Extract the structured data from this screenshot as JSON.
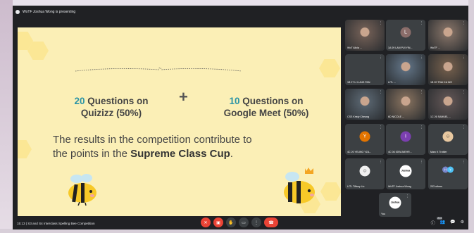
{
  "meeting": {
    "presenting_text": "WoTF Joshua Wong is presenting",
    "time": "15:13",
    "separator": "|",
    "title": "S3 and S4 Interclass Spelling Bee Competition"
  },
  "slide": {
    "quizizz_count": "20",
    "quizizz_rest": "Questions on",
    "quizizz_line2": "Quizizz (50%)",
    "plus": "+",
    "meet_count": "10",
    "meet_rest": "Questions on",
    "meet_line2": "Google Meet (50%)",
    "results_line1": "The results in the competition contribute to",
    "results_line2_pre": "the points in the ",
    "results_line2_bold": "Supreme Class Cup",
    "results_line2_post": "."
  },
  "participants": [
    {
      "name": "WoT Alicia ...",
      "type": "photo"
    },
    {
      "name": "1A 09 LAM PUI YIN...",
      "type": "avatar",
      "initial": "L",
      "color": "#8a6d6a"
    },
    {
      "name": "WoTF ...",
      "type": "photo"
    },
    {
      "name": "1B 27 LI LUNG PAN",
      "type": "dark"
    },
    {
      "name": "LITL ...",
      "type": "photo"
    },
    {
      "name": "1B 20 TSAI KA WO",
      "type": "photo"
    },
    {
      "name": "CSS Kristy Cheung",
      "type": "photo"
    },
    {
      "name": "6D NICOLE ...",
      "type": "photo"
    },
    {
      "name": "1C 26 SAMUEL ...",
      "type": "photo"
    },
    {
      "name": "4C 20 YEUNG YZA...",
      "type": "avatar",
      "initial": "Y",
      "color": "#e37400"
    },
    {
      "name": "4C 06 IGRA MEHR...",
      "type": "avatar",
      "initial": "I",
      "color": "#7b3fb0"
    },
    {
      "name": "Marc K Trottier",
      "type": "cartoon"
    },
    {
      "name": "LITL Tiffany Liu",
      "type": "cartoon2"
    },
    {
      "name": "WoTF Joshua Wong",
      "type": "logo",
      "logo_text": "Joshua"
    },
    {
      "name": "203 others",
      "type": "others",
      "initials": [
        "H",
        "Y"
      ]
    },
    {
      "name": "You",
      "type": "logo",
      "logo_text": "Joshua"
    }
  ],
  "controls": {
    "mic_icon": "mic-off-icon",
    "cam_icon": "camera-off-icon",
    "hand_icon": "raise-hand-icon",
    "present_icon": "present-icon",
    "more_icon": "more-icon",
    "hangup_icon": "hangup-icon"
  },
  "right_tools": {
    "info_icon": "info-icon",
    "people_icon": "people-icon",
    "people_badge": "213",
    "chat_icon": "chat-icon",
    "activities_icon": "activities-icon"
  },
  "colors": {
    "meet_bg": "#202124",
    "tile_bg": "#3c4043",
    "slide_bg": "#fbefb6",
    "accent_teal": "#2b94a6",
    "hangup_red": "#ea4335"
  }
}
